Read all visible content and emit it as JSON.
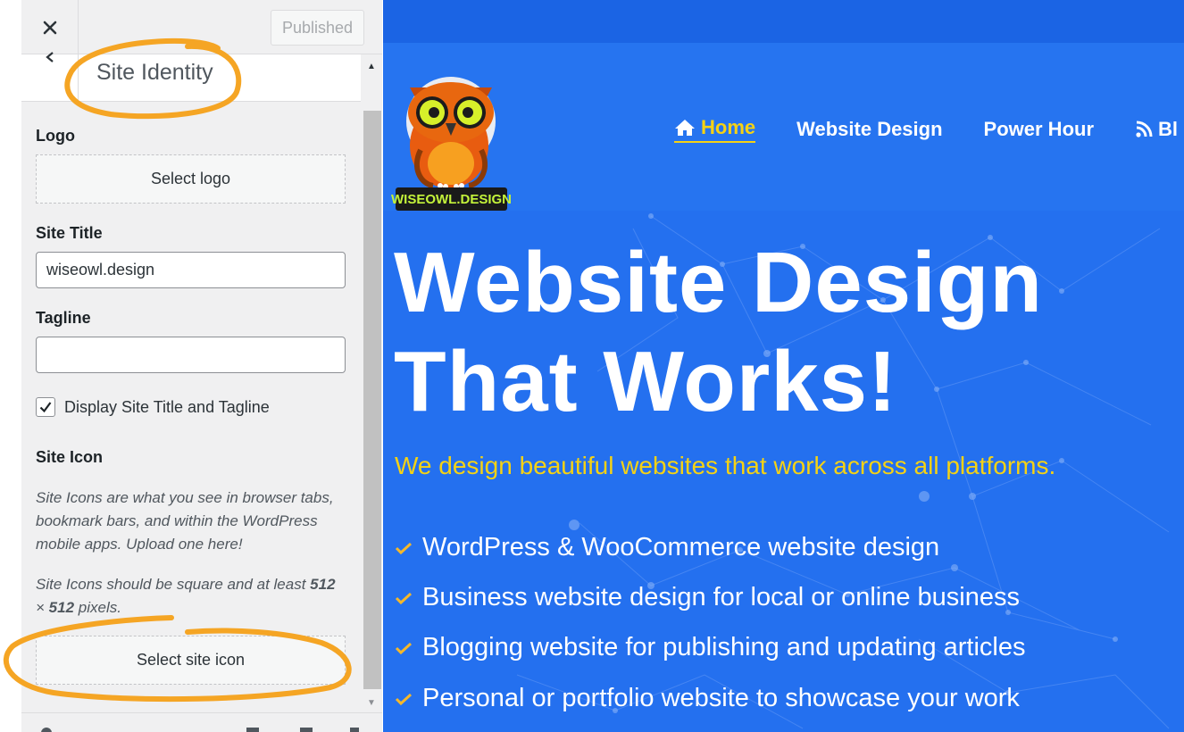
{
  "customizer": {
    "header": {
      "close_icon": "close-icon",
      "publish_label": "Published"
    },
    "section": {
      "back_icon": "chevron-left-icon",
      "title": "Site Identity"
    },
    "logo": {
      "label": "Logo",
      "button": "Select logo"
    },
    "site_title": {
      "label": "Site Title",
      "value": "wiseowl.design"
    },
    "tagline": {
      "label": "Tagline",
      "value": ""
    },
    "display_title": {
      "label": "Display Site Title and Tagline",
      "checked": true
    },
    "site_icon": {
      "label": "Site Icon",
      "description": "Site Icons are what you see in browser tabs, bookmark bars, and within the WordPress mobile apps. Upload one here!",
      "size_note_before": "Site Icons should be square and at least ",
      "size_note_w": "512",
      "size_note_x": " × ",
      "size_note_h": "512",
      "size_note_after": " pixels.",
      "button": "Select site icon"
    },
    "annotation_color": "#f5a524"
  },
  "preview": {
    "colors": {
      "background": "#2674f0",
      "topbar": "#1b64e4",
      "accent": "#f5d214",
      "text": "#ffffff"
    },
    "logo_text": "WISEOWL.DESIGN",
    "nav": [
      {
        "label": "Home",
        "icon": "home-icon",
        "active": true
      },
      {
        "label": "Website Design",
        "active": false
      },
      {
        "label": "Power Hour",
        "active": false
      },
      {
        "label": "Bl",
        "icon": "rss-icon",
        "active": false
      }
    ],
    "headline_line1": "Website Design",
    "headline_line2": "That Works!",
    "subheadline": "We design beautiful websites that work across all platforms.",
    "features": [
      "WordPress & WooCommerce website design",
      "Business website design for local or online business",
      "Blogging website for publishing and updating articles",
      "Personal or portfolio website to showcase your work"
    ]
  }
}
